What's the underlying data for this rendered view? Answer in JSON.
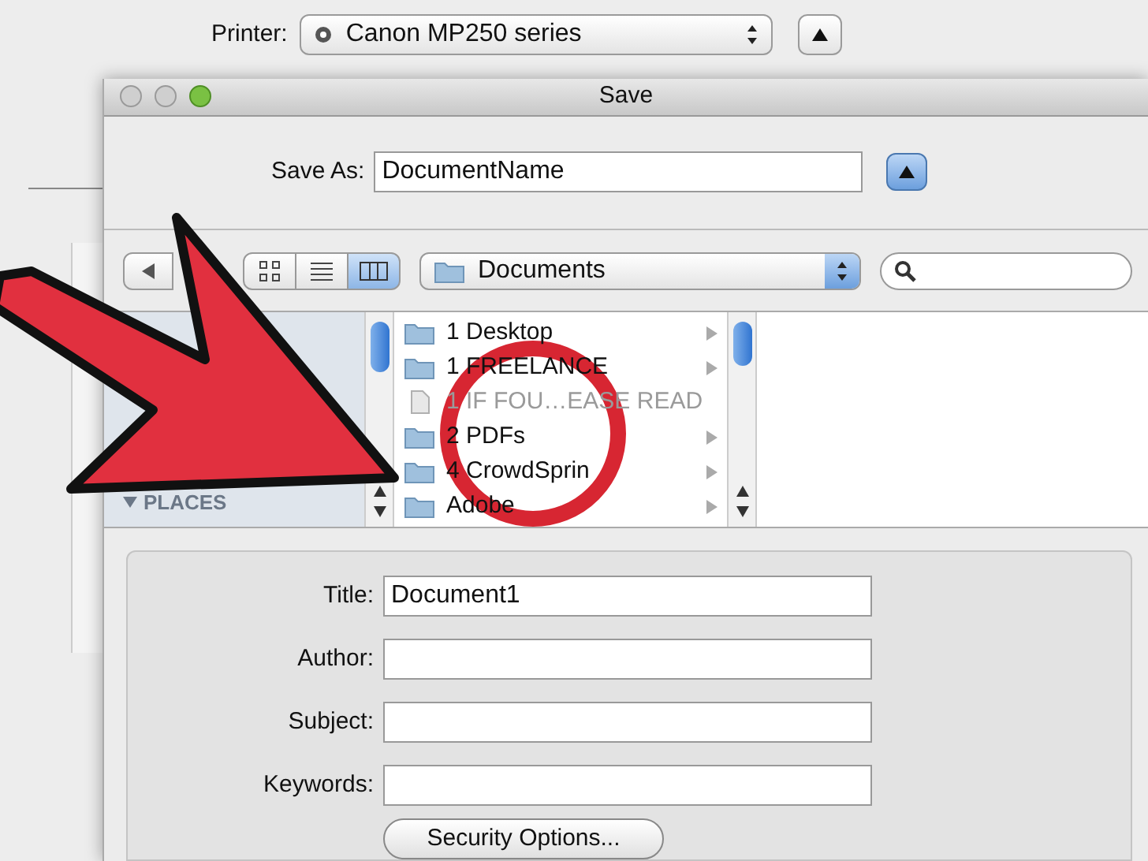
{
  "printer": {
    "label": "Printer:",
    "value": "Canon MP250 series"
  },
  "dialog": {
    "title": "Save",
    "save_as": {
      "label": "Save As:",
      "value": "DocumentName"
    },
    "views": [
      {
        "kind": "icon",
        "selected": false
      },
      {
        "kind": "list",
        "selected": false
      },
      {
        "kind": "column",
        "selected": true
      }
    ],
    "location": "Documents",
    "sidebar": [
      {
        "label": "PLACES",
        "expanded": true
      }
    ],
    "files": [
      {
        "name": "1 Desktop",
        "kind": "folder",
        "disabled": false
      },
      {
        "name": "1 FREELANCE",
        "kind": "folder",
        "disabled": false
      },
      {
        "name": "1 IF FOU…EASE READ",
        "kind": "document",
        "disabled": true
      },
      {
        "name": "2 PDFs",
        "kind": "folder",
        "disabled": false
      },
      {
        "name": "4 CrowdSprin",
        "kind": "folder",
        "disabled": false
      },
      {
        "name": "Adobe",
        "kind": "folder",
        "disabled": false
      }
    ],
    "fields": [
      {
        "label": "Title:",
        "value": "Document1"
      },
      {
        "label": "Author:"
      },
      {
        "label": "Subject:"
      },
      {
        "label": "Keywords:"
      }
    ],
    "security_button": "Security Options..."
  }
}
